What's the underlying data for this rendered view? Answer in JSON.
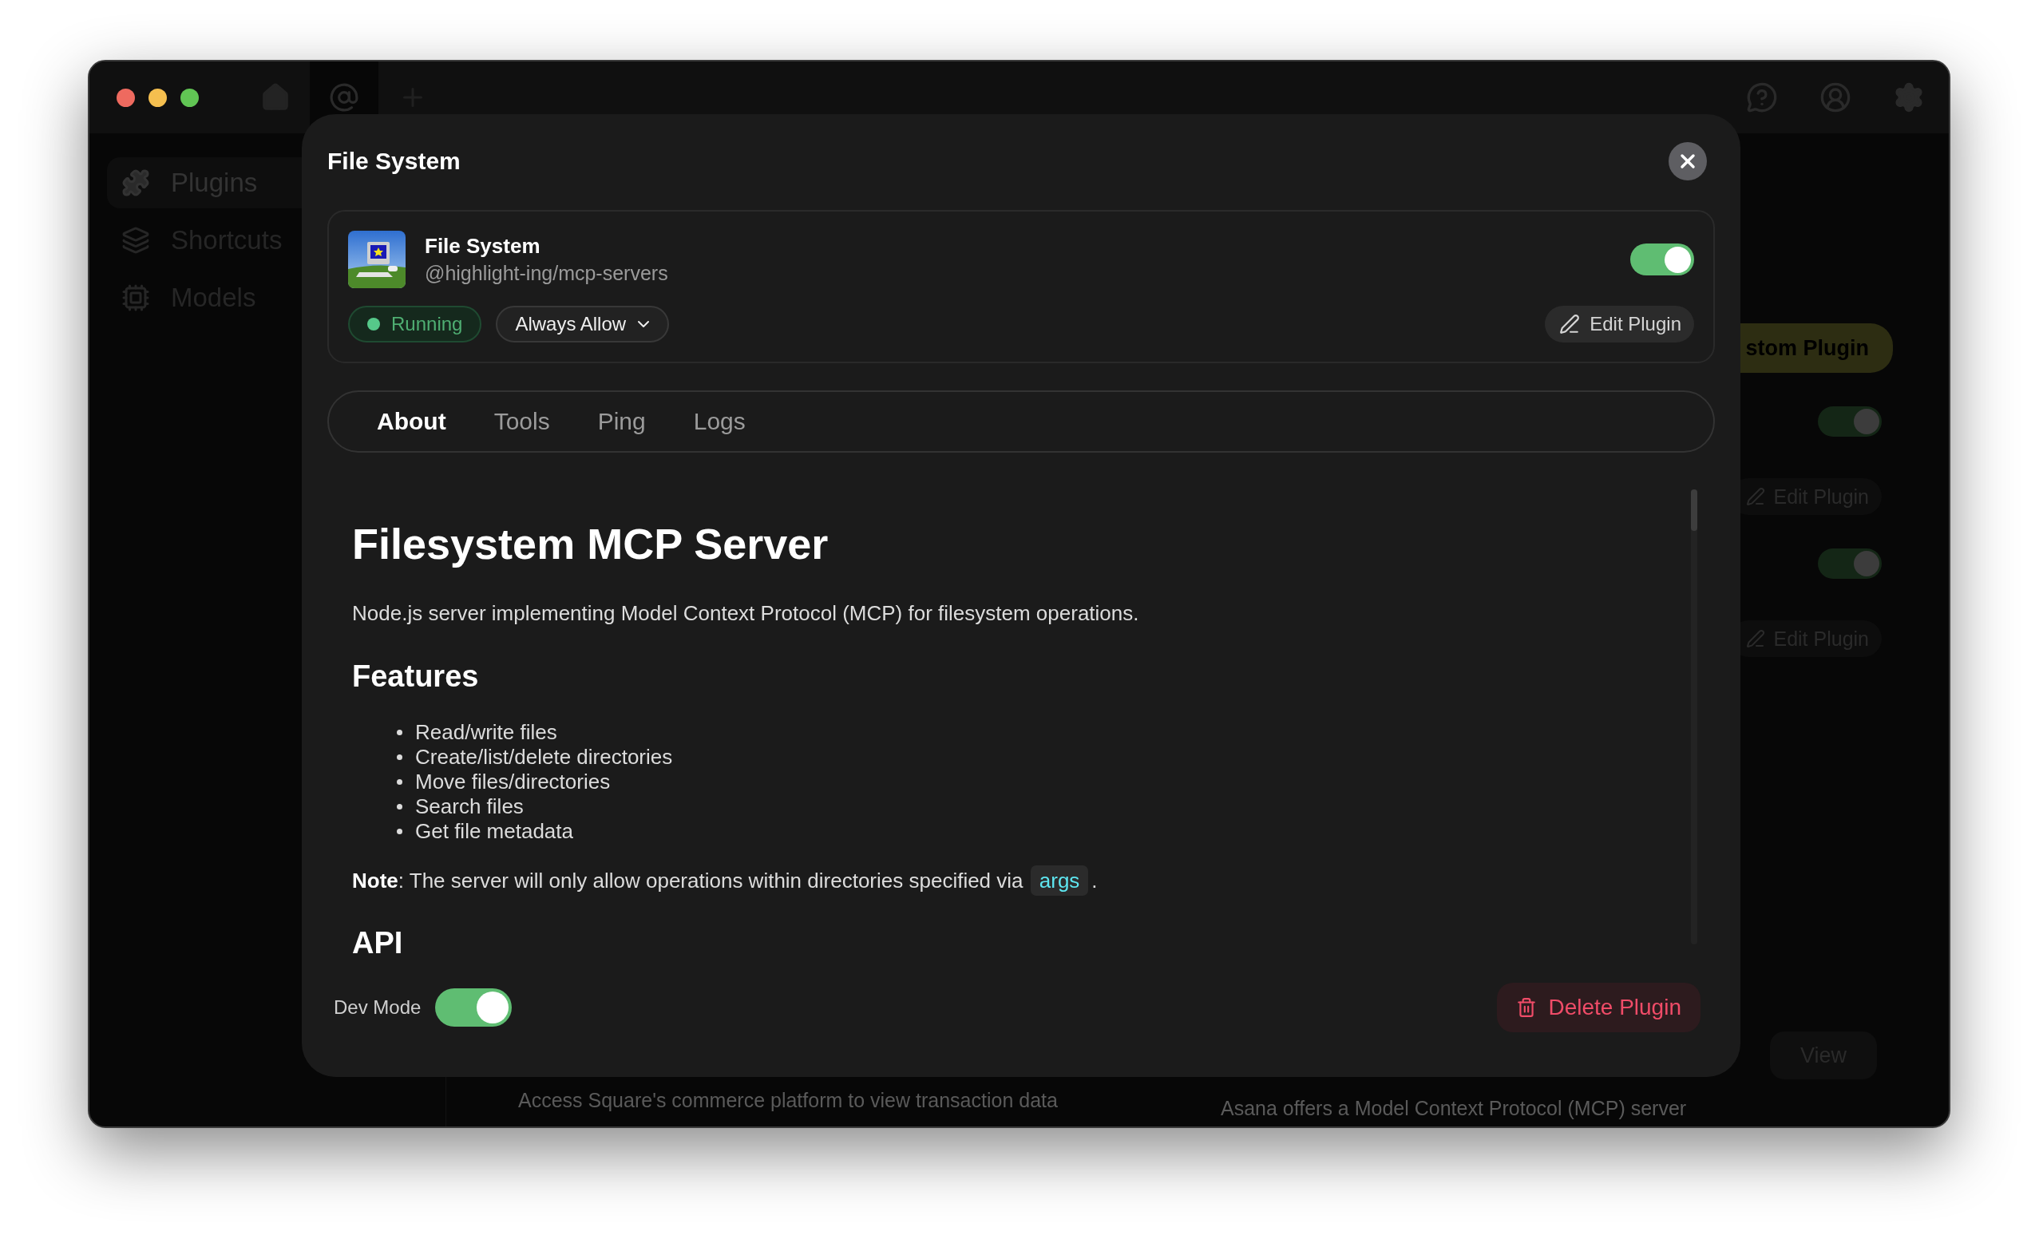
{
  "sidebar": {
    "items": [
      {
        "label": "Plugins",
        "selected": true
      },
      {
        "label": "Shortcuts",
        "selected": false
      },
      {
        "label": "Models",
        "selected": false
      }
    ]
  },
  "background": {
    "add_button": "stom Plugin",
    "plugin_cards": [
      {
        "on": true,
        "edit_label": "Edit Plugin"
      },
      {
        "on": true,
        "edit_label": "Edit Plugin"
      }
    ],
    "bottom_cards": [
      {
        "description": "Access Square's commerce platform to view transaction data"
      },
      {
        "description": "Asana offers a Model Context Protocol (MCP) server",
        "action": "View"
      }
    ]
  },
  "modal": {
    "title": "File System",
    "plugin": {
      "name": "File System",
      "source": "@highlight-ing/mcp-servers",
      "enabled": true,
      "status": "Running",
      "permission": "Always Allow",
      "edit_label": "Edit Plugin"
    },
    "tabs": [
      {
        "label": "About",
        "selected": true
      },
      {
        "label": "Tools",
        "selected": false
      },
      {
        "label": "Ping",
        "selected": false
      },
      {
        "label": "Logs",
        "selected": false
      }
    ],
    "readme": {
      "title": "Filesystem MCP Server",
      "intro": "Node.js server implementing Model Context Protocol (MCP) for filesystem operations.",
      "features_heading": "Features",
      "features": [
        "Read/write files",
        "Create/list/delete directories",
        "Move files/directories",
        "Search files",
        "Get file metadata"
      ],
      "note": "**Note**: The server will only allow operations within directories specified via ",
      "note_code": "args",
      "note_end": ".",
      "api_heading": "API"
    },
    "dev_mode": {
      "label": "Dev Mode",
      "on": true
    },
    "delete_label": "Delete Plugin"
  }
}
